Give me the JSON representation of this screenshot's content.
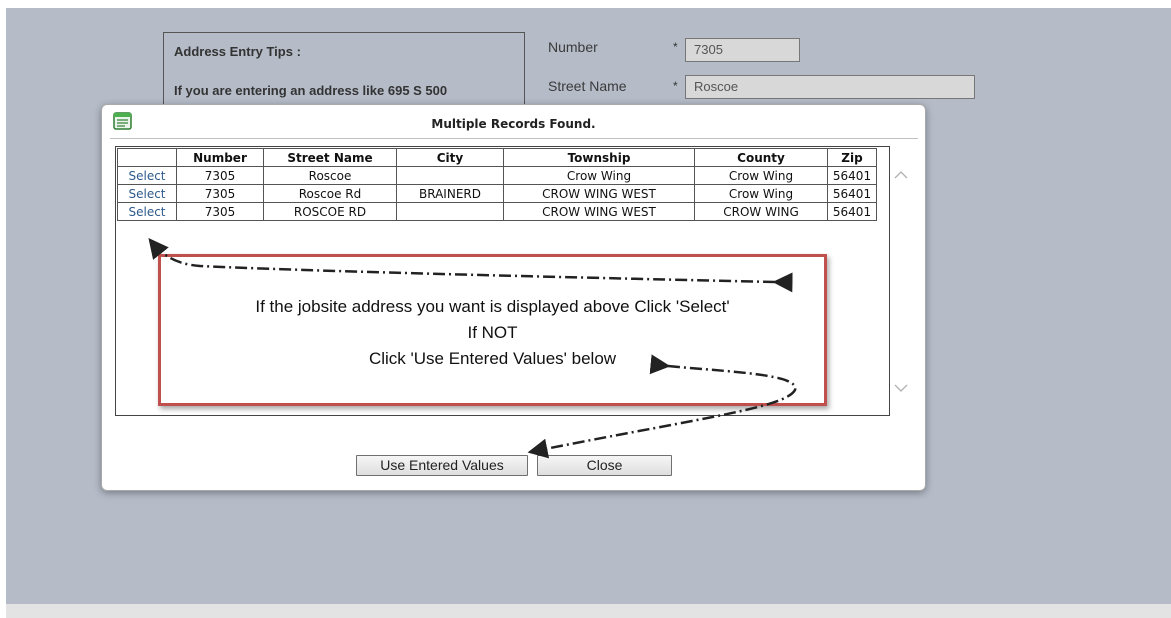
{
  "form": {
    "tips_title": "Address Entry Tips :",
    "tips_text": "If you are entering an address like 695 S 500",
    "number_label": "Number",
    "number_required": "*",
    "number_value": "7305",
    "street_label": "Street Name",
    "street_required": "*",
    "street_value": "Roscoe"
  },
  "dialog": {
    "title": "Multiple Records Found.",
    "icon": "document-list-icon",
    "columns": [
      "",
      "Number",
      "Street Name",
      "City",
      "Township",
      "County",
      "Zip"
    ],
    "rows": [
      {
        "action": "Select",
        "number": "7305",
        "street": "Roscoe",
        "city": "",
        "township": "Crow Wing",
        "county": "Crow Wing",
        "zip": "56401"
      },
      {
        "action": "Select",
        "number": "7305",
        "street": "Roscoe Rd",
        "city": "BRAINERD",
        "township": "CROW WING WEST",
        "county": "Crow Wing",
        "zip": "56401"
      },
      {
        "action": "Select",
        "number": "7305",
        "street": "ROSCOE RD",
        "city": "",
        "township": "CROW WING WEST",
        "county": "CROW WING",
        "zip": "56401"
      }
    ],
    "use_entered_label": "Use Entered Values",
    "close_label": "Close"
  },
  "annotation": {
    "line1": "If the jobsite address you want is displayed above Click 'Select'",
    "line2": "If NOT",
    "line3": "Click 'Use Entered Values' below",
    "border_color": "#c0504d"
  },
  "colors": {
    "page_background": "#b5bcc8",
    "link": "#2d5a8c"
  }
}
